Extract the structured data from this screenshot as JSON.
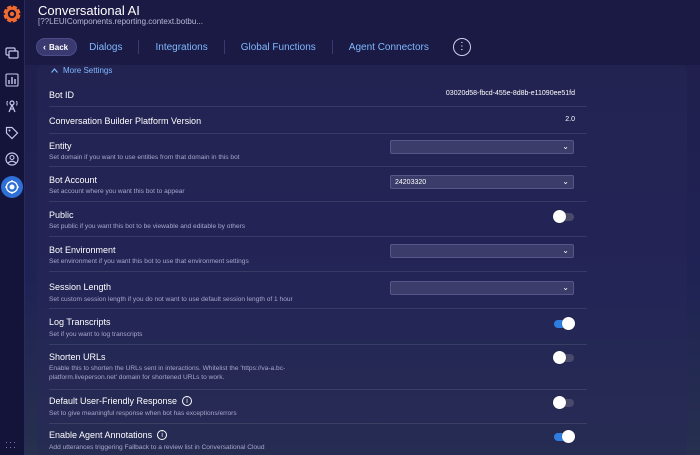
{
  "header": {
    "title": "Conversational AI",
    "subtitle": "[??LEUIComponents.reporting.context.botbu...",
    "back_label": "Back",
    "tabs": [
      "Dialogs",
      "Integrations",
      "Global Functions",
      "Agent Connectors"
    ]
  },
  "settings": {
    "more_label": "More Settings",
    "bot_id": {
      "label": "Bot ID",
      "value": "03020d58-fbcd-455e-8d8b-e11090ee51fd"
    },
    "platform_version": {
      "label": "Conversation Builder Platform Version",
      "value": "2.0"
    },
    "entity": {
      "label": "Entity",
      "desc": "Set domain if you want to use entities from that domain in this bot",
      "value": ""
    },
    "bot_account": {
      "label": "Bot Account",
      "desc": "Set account where you want this bot to appear",
      "value": "24203320"
    },
    "public": {
      "label": "Public",
      "desc": "Set public if you want this bot to be viewable and editable by others",
      "on": false
    },
    "bot_environment": {
      "label": "Bot Environment",
      "desc": "Set environment if you want this bot to use that environment settings",
      "value": ""
    },
    "session_length": {
      "label": "Session Length",
      "desc": "Set custom session length if you do not want to use default session length of 1 hour",
      "value": ""
    },
    "log_transcripts": {
      "label": "Log Transcripts",
      "desc": "Set if you want to log transcripts",
      "on": true
    },
    "shorten_urls": {
      "label": "Shorten URLs",
      "desc_1": "Enable this to shorten the URLs sent in interactions. Whitelist the 'https://va-a.bc-",
      "desc_2": "platform.liveperson.net' domain for shortened URLs to work.",
      "on": false
    },
    "default_response": {
      "label": "Default User-Friendly Response",
      "desc": "Set to give meaningful response when bot has exceptions/errors",
      "on": false
    },
    "agent_annotations": {
      "label": "Enable Agent Annotations",
      "desc": "Add utterances triggering Fallback to a review list in Conversational Cloud",
      "on": true
    }
  },
  "icons": [
    "conversational-ai-logo",
    "chat-icon",
    "analytics-icon",
    "antenna-icon",
    "tag-icon",
    "user-icon",
    "bot-builder-icon"
  ]
}
